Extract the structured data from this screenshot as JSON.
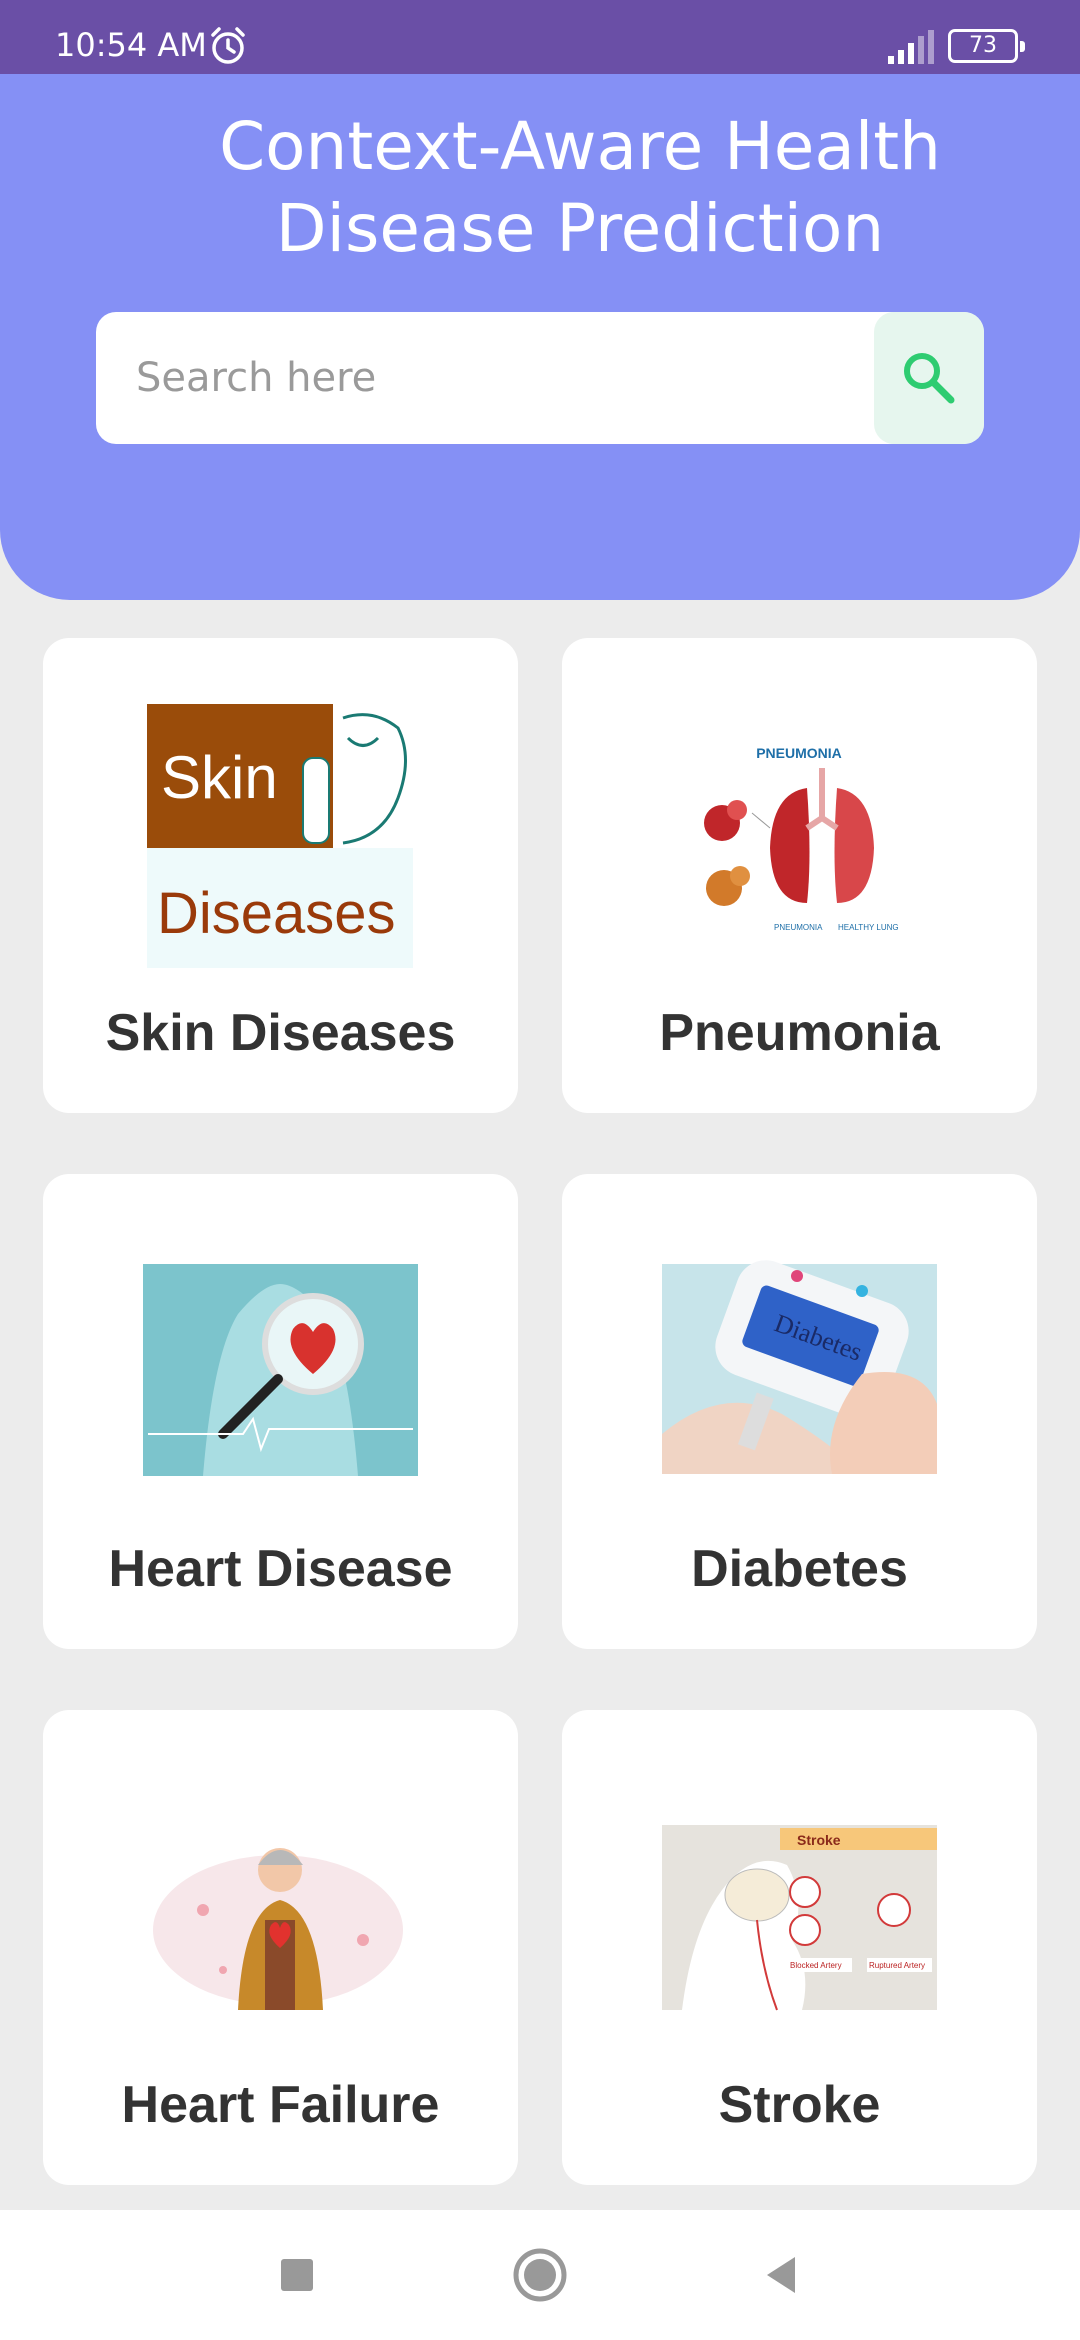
{
  "status_bar": {
    "time": "10:54 AM",
    "battery": "73",
    "icons": [
      "alarm-icon",
      "signal-icon",
      "battery-icon"
    ]
  },
  "header": {
    "title": "Context-Aware Health Disease Prediction"
  },
  "search": {
    "placeholder": "Search here",
    "value": "",
    "icon": "search-icon",
    "accent": "#2ecc71"
  },
  "cards": [
    {
      "label": "Skin Diseases",
      "image": "skin-diseases-image",
      "image_text_top": "Skin",
      "image_text_bottom": "Diseases"
    },
    {
      "label": "Pneumonia",
      "image": "pneumonia-lungs-image",
      "image_text_top": "PNEUMONIA",
      "image_caption_left": "PNEUMONIA",
      "image_caption_right": "HEALTHY LUNG"
    },
    {
      "label": "Heart Disease",
      "image": "heart-magnifier-image"
    },
    {
      "label": "Diabetes",
      "image": "glucose-meter-image",
      "image_text_top": "Diabetes"
    },
    {
      "label": "Heart Failure",
      "image": "heart-failure-illustration"
    },
    {
      "label": "Stroke",
      "image": "stroke-diagram-image",
      "image_text_top": "Stroke",
      "image_caption_left": "Blocked Artery",
      "image_caption_right": "Ruptured Artery"
    }
  ],
  "nav_bar": {
    "buttons": [
      "recent-apps-button",
      "home-button",
      "back-button"
    ]
  },
  "colors": {
    "status_bar": "#6a4fa6",
    "header": "#8590f5",
    "background": "#ececec",
    "card": "#ffffff",
    "label": "#333333"
  }
}
